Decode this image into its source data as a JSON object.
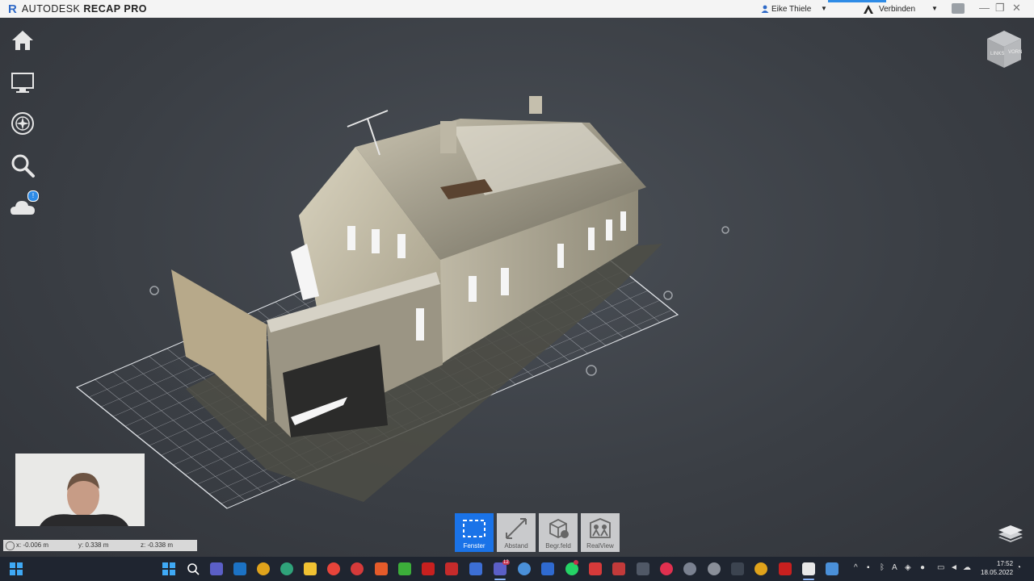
{
  "app": {
    "brand_letter": "R",
    "brand_company": "AUTODESK",
    "brand_product": "RECAP PRO",
    "user_name": "Eike Thiele",
    "connect_label": "Verbinden"
  },
  "sidebar": {
    "items": [
      {
        "name": "home-icon"
      },
      {
        "name": "monitor-icon"
      },
      {
        "name": "navigation-wheel-icon"
      },
      {
        "name": "search-icon"
      },
      {
        "name": "cloud-icon",
        "badge": "!"
      }
    ]
  },
  "viewcube": {
    "face_left": "LINKS",
    "face_front": "VORN"
  },
  "coordinates": {
    "x": "x:  -0.006  m",
    "y": "y:  0.338  m",
    "z": "z:  -0.338  m"
  },
  "tools": [
    {
      "label": "Fenster",
      "icon": "selection-window-icon",
      "active": true
    },
    {
      "label": "Abstand",
      "icon": "distance-icon",
      "active": false
    },
    {
      "label": "Begr.feld",
      "icon": "limit-box-icon",
      "active": false
    },
    {
      "label": "RealView",
      "icon": "realview-icon",
      "active": false
    }
  ],
  "taskbar": {
    "time": "17:52",
    "date": "18.05.2022",
    "teams_badge": "12"
  },
  "colors": {
    "accent": "#1a73e8",
    "titlebar": "#f4f4f4",
    "viewport": "#3b3f45",
    "taskbar": "#1f2530"
  }
}
